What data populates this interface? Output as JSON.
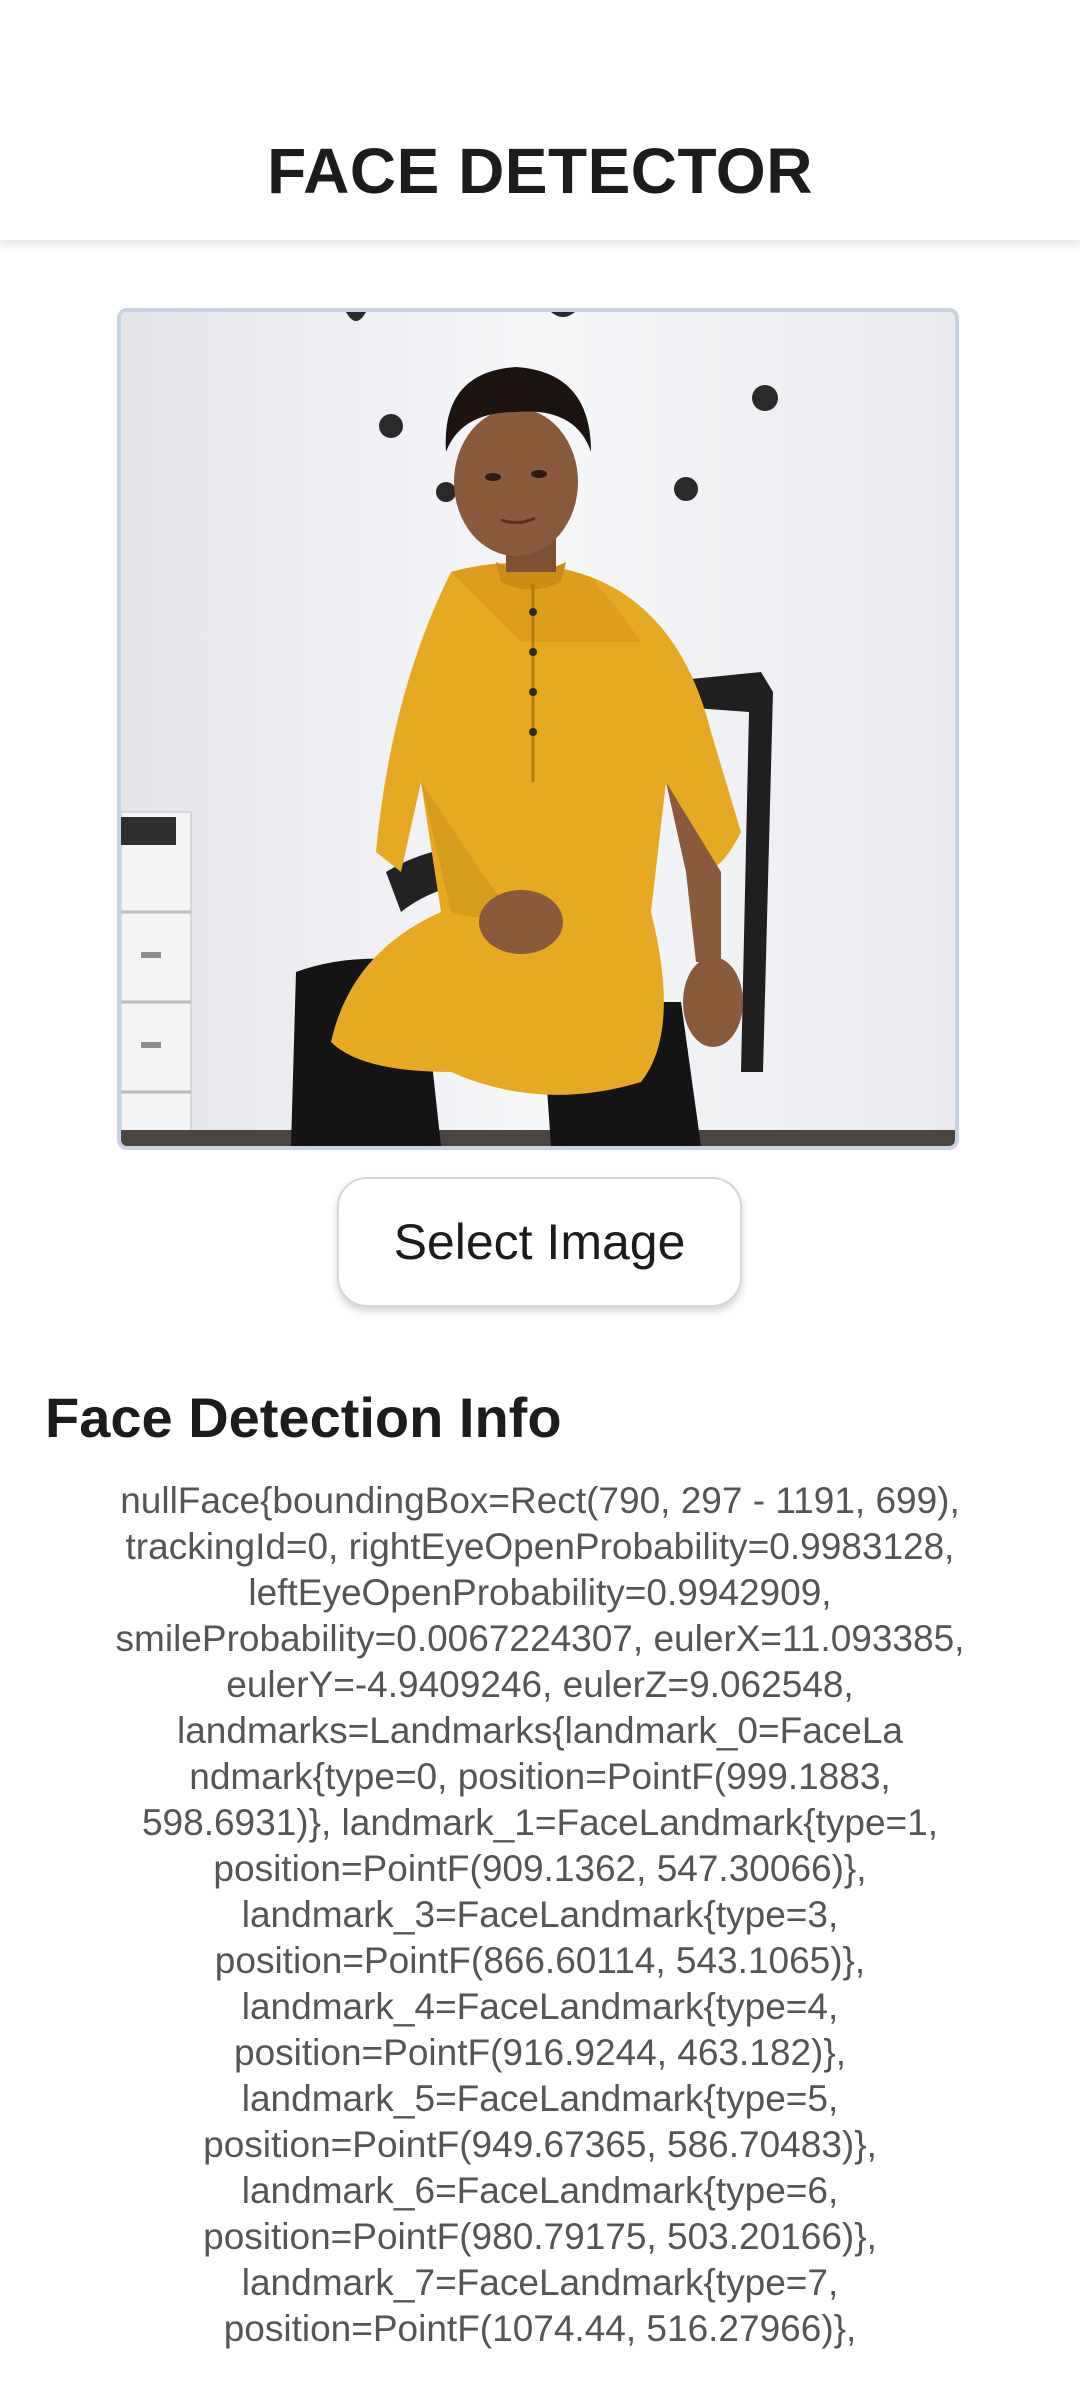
{
  "app_bar": {
    "title": "FACE DETECTOR"
  },
  "preview": {
    "image_description_icon": "photo-person-sitting"
  },
  "actions": {
    "select_image_label": "Select Image"
  },
  "info": {
    "heading": "Face Detection Info",
    "lines": [
      "nullFace{boundingBox=Rect(790, 297 - 1191, 699),",
      "trackingId=0, rightEyeOpenProbability=0.9983128,",
      "leftEyeOpenProbability=0.9942909,",
      "smileProbability=0.0067224307, eulerX=11.093385,",
      "eulerY=-4.9409246, eulerZ=9.062548,",
      "landmarks=Landmarks{landmark_0=FaceLa",
      "ndmark{type=0, position=PointF(999.1883,",
      "598.6931)}, landmark_1=FaceLandmark{type=1,",
      "position=PointF(909.1362, 547.30066)},",
      "landmark_3=FaceLandmark{type=3,",
      "position=PointF(866.60114, 543.1065)},",
      "landmark_4=FaceLandmark{type=4,",
      "position=PointF(916.9244, 463.182)},",
      "landmark_5=FaceLandmark{type=5,",
      "position=PointF(949.67365, 586.70483)},",
      "landmark_6=FaceLandmark{type=6,",
      "position=PointF(980.79175, 503.20166)},",
      "landmark_7=FaceLandmark{type=7,",
      "position=PointF(1074.44, 516.27966)},"
    ]
  },
  "colors": {
    "frame_border": "#c9d3e1",
    "shirt": "#e6a922",
    "text_secondary": "#555555"
  }
}
